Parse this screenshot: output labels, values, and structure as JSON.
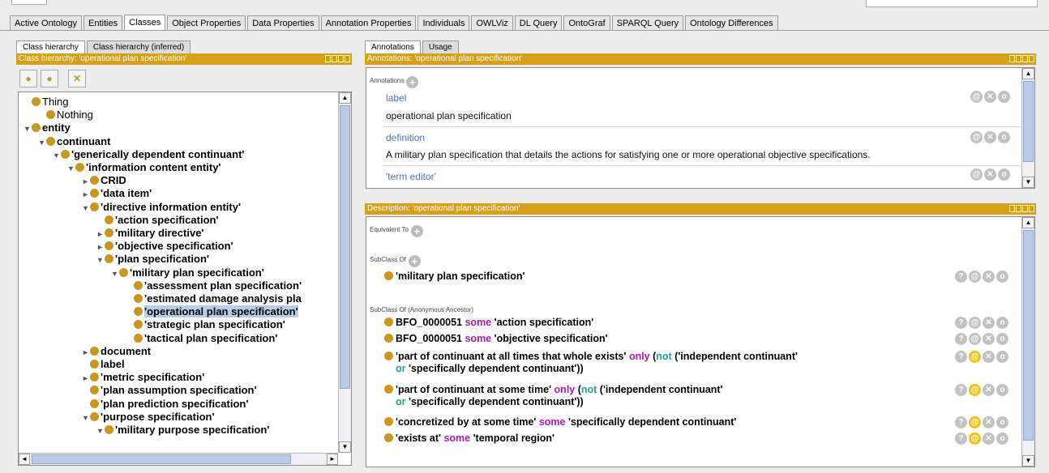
{
  "main_tabs": [
    "Active Ontology",
    "Entities",
    "Classes",
    "Object Properties",
    "Data Properties",
    "Annotation Properties",
    "Individuals",
    "OWLViz",
    "DL Query",
    "OntoGraf",
    "SPARQL Query",
    "Ontology Differences"
  ],
  "left": {
    "subtabs": [
      "Class hierarchy",
      "Class hierarchy (inferred)"
    ],
    "view_header": "Class hierarchy: 'operational plan specification'",
    "tree": [
      {
        "label": "Thing",
        "depth": 0,
        "toggle": "",
        "bold": false
      },
      {
        "label": "Nothing",
        "depth": 1,
        "toggle": "",
        "bold": false
      },
      {
        "label": "entity",
        "depth": 0,
        "toggle": "▼",
        "bold": true
      },
      {
        "label": "continuant",
        "depth": 1,
        "toggle": "▼",
        "bold": true
      },
      {
        "label": "'generically dependent continuant'",
        "depth": 2,
        "toggle": "▼",
        "bold": true
      },
      {
        "label": "'information content entity'",
        "depth": 3,
        "toggle": "▼",
        "bold": true
      },
      {
        "label": "CRID",
        "depth": 4,
        "toggle": "►",
        "bold": true
      },
      {
        "label": "'data item'",
        "depth": 4,
        "toggle": "►",
        "bold": true
      },
      {
        "label": "'directive information entity'",
        "depth": 4,
        "toggle": "▼",
        "bold": true
      },
      {
        "label": "'action specification'",
        "depth": 5,
        "toggle": "",
        "bold": true
      },
      {
        "label": "'military directive'",
        "depth": 5,
        "toggle": "►",
        "bold": true
      },
      {
        "label": "'objective specification'",
        "depth": 5,
        "toggle": "►",
        "bold": true
      },
      {
        "label": "'plan specification'",
        "depth": 5,
        "toggle": "▼",
        "bold": true
      },
      {
        "label": "'military plan specification'",
        "depth": 6,
        "toggle": "▼",
        "bold": true
      },
      {
        "label": "'assessment plan specification'",
        "depth": 7,
        "toggle": "",
        "bold": true
      },
      {
        "label": "'estimated damage analysis pla",
        "depth": 7,
        "toggle": "",
        "bold": true
      },
      {
        "label": "'operational plan specification'",
        "depth": 7,
        "toggle": "",
        "bold": true,
        "selected": true
      },
      {
        "label": "'strategic plan specification'",
        "depth": 7,
        "toggle": "",
        "bold": true
      },
      {
        "label": "'tactical plan specification'",
        "depth": 7,
        "toggle": "",
        "bold": true
      },
      {
        "label": "document",
        "depth": 4,
        "toggle": "►",
        "bold": true
      },
      {
        "label": "label",
        "depth": 4,
        "toggle": "",
        "bold": true
      },
      {
        "label": "'metric specification'",
        "depth": 4,
        "toggle": "►",
        "bold": true
      },
      {
        "label": "'plan assumption specification'",
        "depth": 4,
        "toggle": "",
        "bold": true
      },
      {
        "label": "'plan prediction specification'",
        "depth": 4,
        "toggle": "",
        "bold": true
      },
      {
        "label": "'purpose specification'",
        "depth": 4,
        "toggle": "▼",
        "bold": true
      },
      {
        "label": "'military purpose specification'",
        "depth": 5,
        "toggle": "▼",
        "bold": true
      }
    ]
  },
  "right_top": {
    "subtabs": [
      "Annotations",
      "Usage"
    ],
    "view_header": "Annotations: 'operational plan specification'",
    "section": "Annotations",
    "items": [
      {
        "property": "label",
        "value": "operational plan specification"
      },
      {
        "property": "definition",
        "value": "A military plan specification that details the actions for satisfying one or more operational objective specifications."
      },
      {
        "property": "'term editor'",
        "value": ""
      }
    ]
  },
  "right_bottom": {
    "view_header": "Description: 'operational plan specification'",
    "equivalent_to": "Equivalent To",
    "subclass_of": "SubClass Of",
    "subclass_anon": "SubClass Of (Anonymous Ancestor)",
    "superclass": "'military plan specification'",
    "anon": [
      {
        "pre": "BFO_0000051 ",
        "kw": "some",
        "post": " 'action specification'"
      },
      {
        "pre": "BFO_0000051 ",
        "kw": "some",
        "post": " 'objective specification'"
      },
      {
        "pre": "'part of continuant at all times that whole exists' ",
        "kw": "only",
        "mid1": " (",
        "kw2": "not",
        "mid2": " ('independent continuant'",
        "line2kw": "or",
        "line2": " 'specifically dependent continuant'))"
      },
      {
        "pre": "'part of continuant at some time' ",
        "kw": "only",
        "mid1": " (",
        "kw2": "not",
        "mid2": " ('independent continuant'",
        "line2kw": "or",
        "line2": " 'specifically dependent continuant'))"
      },
      {
        "pre": "'concretized by at some time' ",
        "kw": "some",
        "post": " 'specifically dependent continuant'"
      },
      {
        "pre": "'exists at' ",
        "kw": "some",
        "post": " 'temporal region'"
      }
    ]
  }
}
